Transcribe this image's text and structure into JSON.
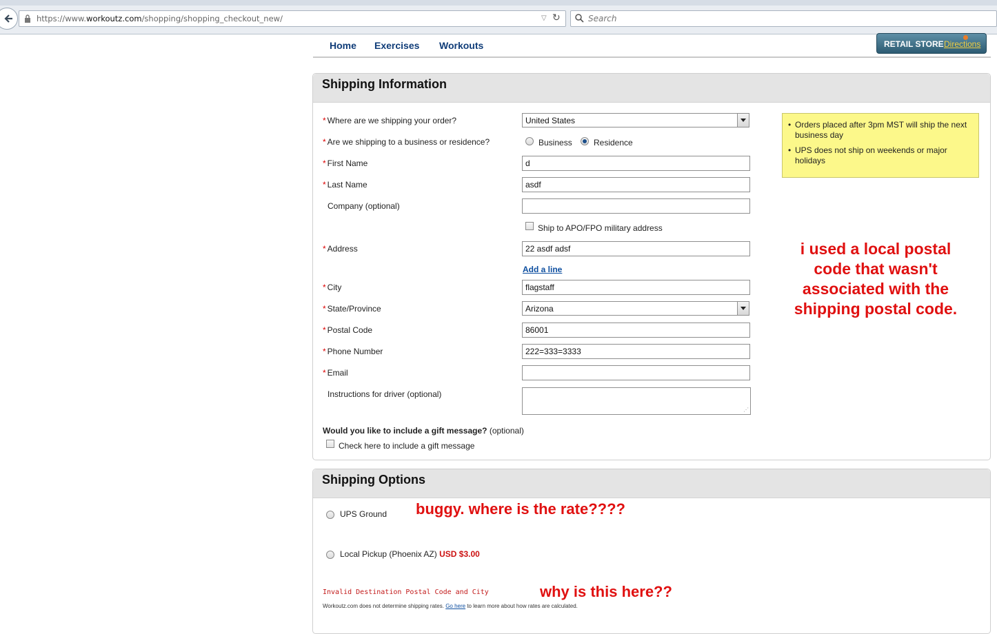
{
  "browser": {
    "url_prefix": "https://www.",
    "url_domain": "workoutz.com",
    "url_path": "/shopping/shopping_checkout_new/",
    "search_placeholder": "Search"
  },
  "nav": {
    "items": [
      "Home",
      "Exercises",
      "Workouts"
    ],
    "retail_store": "RETAIL STORE",
    "directions": "Directions"
  },
  "shipping_info": {
    "title": "Shipping Information",
    "required_mark": "*",
    "fields": {
      "country_label": "Where are we shipping your order?",
      "country_value": "United States",
      "addr_type_label": "Are we shipping to a business or residence?",
      "business": "Business",
      "residence": "Residence",
      "residence_selected": true,
      "first_name_label": "First Name",
      "first_name": "d",
      "last_name_label": "Last Name",
      "last_name": "asdf",
      "company_label": "Company (optional)",
      "company": "",
      "apo_label": "Ship to APO/FPO military address",
      "address_label": "Address",
      "address": "22 asdf adsf",
      "add_line": "Add a line",
      "city_label": "City",
      "city": "flagstaff",
      "state_label": "State/Province",
      "state_value": "Arizona",
      "postal_label": "Postal Code",
      "postal": "86001",
      "phone_label": "Phone Number",
      "phone": "222=333=3333",
      "email_label": "Email",
      "email": "",
      "instructions_label": "Instructions for driver (optional)",
      "gift_question": "Would you like to include a gift message?",
      "gift_optional": "(optional)",
      "gift_check": "Check here to include a gift message"
    },
    "notes": [
      "Orders placed after 3pm MST will ship the next business day",
      "UPS does not ship on weekends or major holidays"
    ]
  },
  "shipping_options": {
    "title": "Shipping Options",
    "ups": "UPS Ground",
    "pickup": "Local Pickup (Phoenix AZ)",
    "pickup_price": "USD $3.00",
    "error": "Invalid Destination Postal Code and City",
    "disclaimer_pre": "Workoutz.com does not determine shipping rates.",
    "go_here": "Go here",
    "disclaimer_post": "to learn more about how rates are calculated."
  },
  "annotations": {
    "postal_note": "i used a local postal code that wasn't associated with the shipping postal code.",
    "rate_note": "buggy. where is the rate????",
    "why_note": "why is this here??"
  },
  "colors": {
    "annotation": "#e01010",
    "nav_link": "#0f3c78",
    "note_bg": "#fcf88a"
  }
}
